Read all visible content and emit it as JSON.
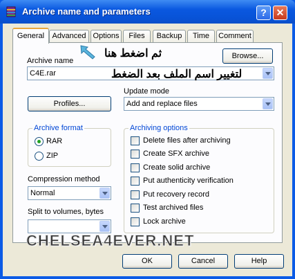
{
  "window": {
    "title": "Archive name and parameters",
    "help_glyph": "?",
    "close_glyph": "✕"
  },
  "tabs": [
    {
      "label": "General",
      "active": true
    },
    {
      "label": "Advanced"
    },
    {
      "label": "Options"
    },
    {
      "label": "Files"
    },
    {
      "label": "Backup"
    },
    {
      "label": "Time"
    },
    {
      "label": "Comment"
    }
  ],
  "annotations": {
    "press_here": "ثم اضغط هنا",
    "rename_hint": "لتغيير اسم الملف بعد الضغط"
  },
  "archive_name": {
    "label": "Archive name",
    "value": "C4E.rar",
    "browse_label": "Browse..."
  },
  "update_mode": {
    "label": "Update mode",
    "value": "Add and replace files"
  },
  "profiles_label": "Profiles...",
  "archive_format": {
    "legend": "Archive format",
    "options": [
      {
        "label": "RAR",
        "checked": true
      },
      {
        "label": "ZIP",
        "checked": false
      }
    ]
  },
  "compression": {
    "label": "Compression method",
    "value": "Normal"
  },
  "split": {
    "label": "Split to volumes, bytes",
    "value": ""
  },
  "archiving_options": {
    "legend": "Archiving options",
    "items": [
      "Delete files after archiving",
      "Create SFX archive",
      "Create solid archive",
      "Put authenticity verification",
      "Put recovery record",
      "Test archived files",
      "Lock archive"
    ]
  },
  "watermark": "CHELSEA4EVER.NET",
  "buttons": {
    "ok": "OK",
    "cancel": "Cancel",
    "help": "Help"
  },
  "colors": {
    "titlebar": "#0a58e0",
    "dialog_bg": "#ece9d8",
    "group_legend": "#0046d5",
    "active_tab_accent": "#e9a63b"
  }
}
